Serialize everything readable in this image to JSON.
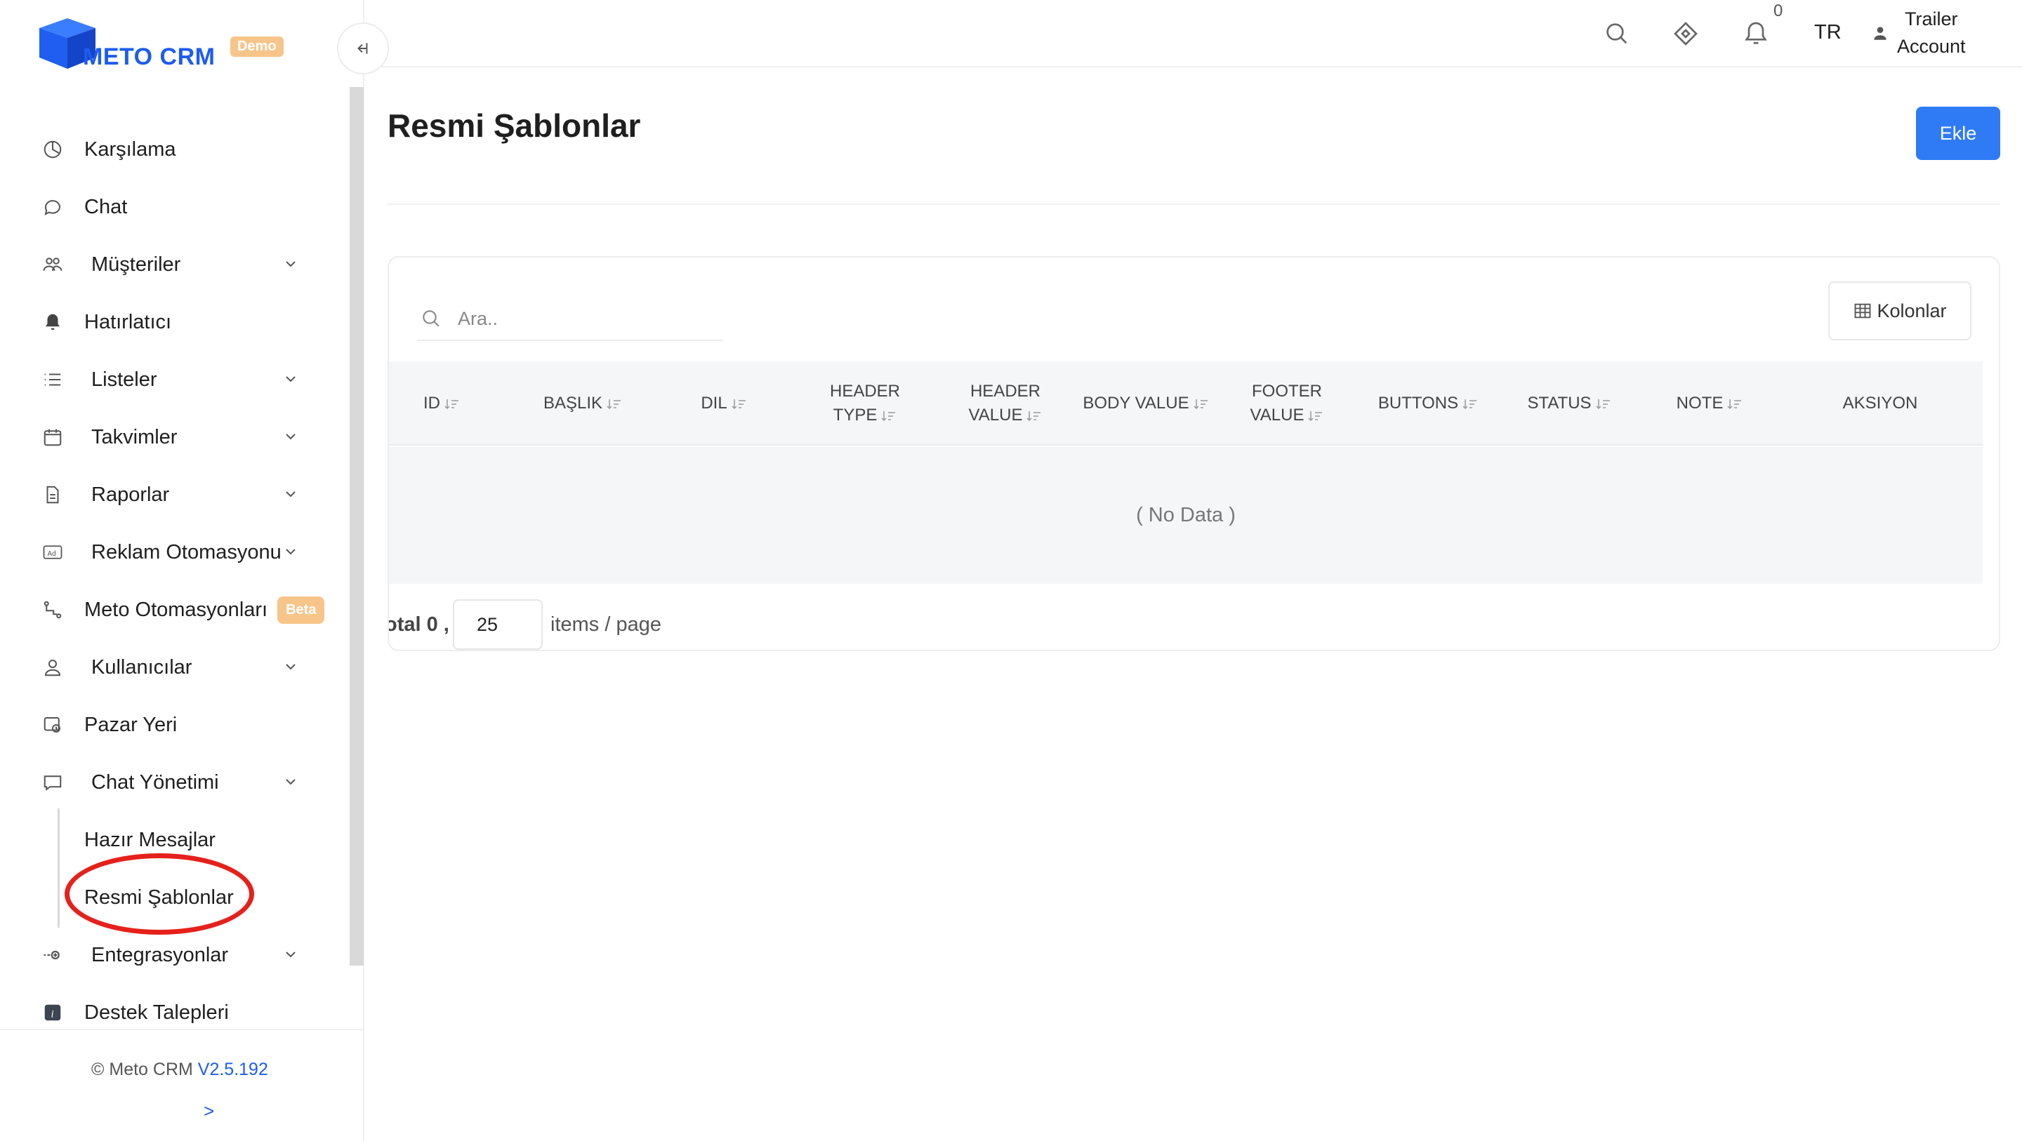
{
  "brand": {
    "name": "METO CRM",
    "badge": "Demo"
  },
  "sidebar": {
    "items": [
      {
        "label": "Karşılama",
        "icon": "dashboard-icon",
        "chevron": false
      },
      {
        "label": "Chat",
        "icon": "chat-bubble-icon",
        "chevron": false
      },
      {
        "label": "Müşteriler",
        "icon": "users-icon",
        "chevron": true
      },
      {
        "label": "Hatırlatıcı",
        "icon": "bell-icon",
        "chevron": false
      },
      {
        "label": "Listeler",
        "icon": "list-icon",
        "chevron": true
      },
      {
        "label": "Takvimler",
        "icon": "calendar-icon",
        "chevron": true
      },
      {
        "label": "Raporlar",
        "icon": "report-file-icon",
        "chevron": true
      },
      {
        "label": "Reklam Otomasyonu",
        "icon": "ad-icon",
        "chevron": true
      },
      {
        "label": "Meto Otomasyonları",
        "icon": "automation-icon",
        "chevron": false,
        "badge": "Beta"
      },
      {
        "label": "Kullanıcılar",
        "icon": "user-icon",
        "chevron": true
      },
      {
        "label": "Pazar Yeri",
        "icon": "marketplace-icon",
        "chevron": false
      },
      {
        "label": "Chat Yönetimi",
        "icon": "chat-settings-icon",
        "chevron": true
      },
      {
        "label": "Hazır Mesajlar",
        "sub": true
      },
      {
        "label": "Resmi Şablonlar",
        "sub": true,
        "active": true
      },
      {
        "label": "Entegrasyonlar",
        "icon": "integration-icon",
        "chevron": true
      },
      {
        "label": "Destek Talepleri",
        "icon": "info-icon",
        "chevron": false
      }
    ],
    "footer": {
      "copyright": "© Meto CRM",
      "version": "V2.5.192",
      "expand": ">"
    }
  },
  "topbar": {
    "notification_count": "0",
    "language": "TR",
    "user_line1": "Trailer",
    "user_line2": "Account"
  },
  "main": {
    "title": "Resmi Şablonlar",
    "add_label": "Ekle",
    "search_placeholder": "Ara..",
    "columns_label": "Kolonlar",
    "table": {
      "headers": [
        {
          "line1": "ID",
          "line2": ""
        },
        {
          "line1": "BAŞLIK",
          "line2": ""
        },
        {
          "line1": "DIL",
          "line2": ""
        },
        {
          "line1": "HEADER",
          "line2": "TYPE"
        },
        {
          "line1": "HEADER",
          "line2": "VALUE"
        },
        {
          "line1": "BODY VALUE",
          "line2": ""
        },
        {
          "line1": "FOOTER",
          "line2": "VALUE"
        },
        {
          "line1": "BUTTONS",
          "line2": ""
        },
        {
          "line1": "STATUS",
          "line2": ""
        },
        {
          "line1": "NOTE",
          "line2": ""
        },
        {
          "line1": "AKSIYON",
          "line2": ""
        }
      ],
      "empty_text": "( No Data )"
    },
    "pagination": {
      "total_text": "otal 0 ,",
      "page_size": "25",
      "per_page_text": "items / page"
    }
  },
  "colors": {
    "accent": "#2f7bf5",
    "brand": "#1d5cf0",
    "badge": "#f7c58a",
    "highlight": "#e6201b"
  }
}
